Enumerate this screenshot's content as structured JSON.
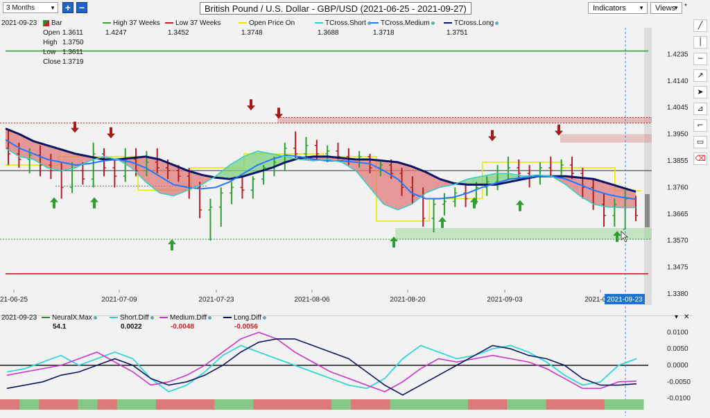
{
  "toolbar": {
    "range": "3 Months",
    "zoom_in": "+",
    "zoom_out": "−",
    "title": "British Pound / U.S. Dollar - GBP/USD (2021-06-25 - 2021-09-27)",
    "indicators": "Indicators",
    "views": "Views",
    "views_star": "*"
  },
  "legend": {
    "date": "2021-09-23",
    "bar_label": "Bar",
    "ohlc_labels": [
      "Open",
      "High",
      "Low",
      "Close"
    ],
    "ohlc_values": [
      "1.3611",
      "1.3750",
      "1.3611",
      "1.3719"
    ],
    "items": [
      {
        "name": "High 37 Weeks",
        "value": "1.4247",
        "color": "#3aa13a"
      },
      {
        "name": "Low 37 Weeks",
        "value": "1.3452",
        "color": "#cc1f1f"
      },
      {
        "name": "Open Price On",
        "value": "1.3748",
        "color": "#e8e800"
      },
      {
        "name": "TCross.Short",
        "value": "1.3688",
        "color": "#33cccc"
      },
      {
        "name": "TCross.Medium",
        "value": "1.3718",
        "color": "#2277ff"
      },
      {
        "name": "TCross.Long",
        "value": "1.3751",
        "color": "#0a1466"
      }
    ]
  },
  "lower_legend": {
    "date": "2021-09-23",
    "items": [
      {
        "name": "NeuralX.Max",
        "value": "54.1",
        "color": "#2e8b2e",
        "value_color": "#111111"
      },
      {
        "name": "Short.Diff",
        "value": "0.0022",
        "color": "#33cccc",
        "value_color": "#111111"
      },
      {
        "name": "Medium.Diff",
        "value": "-0.0048",
        "color": "#cc33cc",
        "value_color": "#cc1f1f"
      },
      {
        "name": "Long.Diff",
        "value": "-0.0056",
        "color": "#0a1466",
        "value_color": "#cc1f1f"
      }
    ],
    "ctrl_down": "▾",
    "ctrl_close": "✕"
  },
  "tools": [
    {
      "name": "draw-line-icon",
      "glyph": "╱"
    },
    {
      "name": "vertical-line-icon",
      "glyph": "│"
    },
    {
      "name": "horizontal-line-icon",
      "glyph": "─"
    },
    {
      "name": "ray-icon",
      "glyph": "↗"
    },
    {
      "name": "pointer-icon",
      "glyph": "➤"
    },
    {
      "name": "pitchfork-icon",
      "glyph": "⊿"
    },
    {
      "name": "bracket-icon",
      "glyph": "⌐"
    },
    {
      "name": "rectangle-icon",
      "glyph": "▭"
    },
    {
      "name": "delete-drawing-icon",
      "glyph": "⌫"
    }
  ],
  "chart_data": [
    {
      "type": "line",
      "ylim": [
        1.338,
        1.433
      ],
      "y_ticks": [
        "1.4235",
        "1.4140",
        "1.4045",
        "1.3950",
        "1.3855",
        "1.3760",
        "1.3665",
        "1.3570",
        "1.3475",
        "1.3380"
      ],
      "x_labels": [
        "21-06-25",
        "2021-07-09",
        "2021-07-23",
        "2021-08-06",
        "2021-08-20",
        "2021-09-03",
        "2021-09-1"
      ],
      "cursor_label": "2021-09-23",
      "current_price": "1.3719",
      "grid": false,
      "levels": {
        "high_37_weeks": 1.4247,
        "low_37_weeks": 1.3452,
        "open_price": 1.3748
      },
      "bars": [
        [
          1.39,
          1.3965,
          1.384,
          1.388
        ],
        [
          1.388,
          1.392,
          1.383,
          1.386
        ],
        [
          1.386,
          1.39,
          1.381,
          1.3875
        ],
        [
          1.3875,
          1.391,
          1.38,
          1.384
        ],
        [
          1.384,
          1.388,
          1.379,
          1.382
        ],
        [
          1.382,
          1.385,
          1.372,
          1.376
        ],
        [
          1.376,
          1.385,
          1.374,
          1.382
        ],
        [
          1.382,
          1.385,
          1.377,
          1.379
        ],
        [
          1.379,
          1.392,
          1.376,
          1.388
        ],
        [
          1.388,
          1.39,
          1.38,
          1.383
        ],
        [
          1.383,
          1.386,
          1.376,
          1.38
        ],
        [
          1.38,
          1.39,
          1.378,
          1.386
        ],
        [
          1.386,
          1.39,
          1.38,
          1.382
        ],
        [
          1.382,
          1.389,
          1.38,
          1.385
        ],
        [
          1.385,
          1.39,
          1.381,
          1.383
        ],
        [
          1.383,
          1.386,
          1.379,
          1.382
        ],
        [
          1.382,
          1.384,
          1.378,
          1.38
        ],
        [
          1.38,
          1.383,
          1.372,
          1.376
        ],
        [
          1.376,
          1.378,
          1.365,
          1.368
        ],
        [
          1.368,
          1.372,
          1.357,
          1.369
        ],
        [
          1.369,
          1.376,
          1.362,
          1.374
        ],
        [
          1.374,
          1.378,
          1.37,
          1.376
        ],
        [
          1.376,
          1.38,
          1.372,
          1.375
        ],
        [
          1.375,
          1.38,
          1.372,
          1.379
        ],
        [
          1.379,
          1.384,
          1.377,
          1.383
        ],
        [
          1.383,
          1.387,
          1.38,
          1.385
        ],
        [
          1.385,
          1.392,
          1.382,
          1.39
        ],
        [
          1.39,
          1.396,
          1.386,
          1.388
        ],
        [
          1.388,
          1.394,
          1.386,
          1.391
        ],
        [
          1.391,
          1.393,
          1.386,
          1.388
        ],
        [
          1.388,
          1.391,
          1.385,
          1.389
        ],
        [
          1.389,
          1.392,
          1.386,
          1.387
        ],
        [
          1.387,
          1.39,
          1.384,
          1.386
        ],
        [
          1.386,
          1.389,
          1.383,
          1.387
        ],
        [
          1.387,
          1.388,
          1.381,
          1.383
        ],
        [
          1.383,
          1.386,
          1.38,
          1.384
        ],
        [
          1.384,
          1.386,
          1.379,
          1.381
        ],
        [
          1.381,
          1.383,
          1.373,
          1.376
        ],
        [
          1.376,
          1.38,
          1.37,
          1.373
        ],
        [
          1.373,
          1.376,
          1.362,
          1.365
        ],
        [
          1.365,
          1.372,
          1.36,
          1.37
        ],
        [
          1.37,
          1.374,
          1.366,
          1.371
        ],
        [
          1.371,
          1.376,
          1.369,
          1.374
        ],
        [
          1.374,
          1.377,
          1.369,
          1.372
        ],
        [
          1.372,
          1.378,
          1.37,
          1.376
        ],
        [
          1.376,
          1.38,
          1.373,
          1.378
        ],
        [
          1.378,
          1.384,
          1.375,
          1.382
        ],
        [
          1.382,
          1.387,
          1.379,
          1.383
        ],
        [
          1.383,
          1.386,
          1.379,
          1.381
        ],
        [
          1.381,
          1.384,
          1.376,
          1.38
        ],
        [
          1.38,
          1.385,
          1.377,
          1.383
        ],
        [
          1.383,
          1.387,
          1.38,
          1.382
        ],
        [
          1.382,
          1.386,
          1.38,
          1.384
        ],
        [
          1.384,
          1.387,
          1.379,
          1.381
        ],
        [
          1.381,
          1.383,
          1.372,
          1.376
        ],
        [
          1.376,
          1.379,
          1.368,
          1.37
        ],
        [
          1.37,
          1.374,
          1.362,
          1.366
        ],
        [
          1.366,
          1.372,
          1.362,
          1.37
        ],
        [
          1.3611,
          1.375,
          1.3611,
          1.3719
        ],
        [
          1.3719,
          1.373,
          1.364,
          1.366
        ]
      ],
      "series": [
        {
          "name": "TCross.Long",
          "values": [
            1.397,
            1.395,
            1.3925,
            1.391,
            1.3895,
            1.388,
            1.387,
            1.386,
            1.386,
            1.3865,
            1.387,
            1.386,
            1.384,
            1.382,
            1.3805,
            1.3795,
            1.379,
            1.38,
            1.3815,
            1.383,
            1.385,
            1.3865,
            1.387,
            1.387,
            1.3865,
            1.386,
            1.386,
            1.3855,
            1.385,
            1.3835,
            1.3815,
            1.379,
            1.3775,
            1.377,
            1.377,
            1.377,
            1.378,
            1.379,
            1.38,
            1.38,
            1.38,
            1.3795,
            1.379,
            1.3775,
            1.376,
            1.3745
          ]
        },
        {
          "name": "TCross.Medium",
          "values": [
            1.393,
            1.39,
            1.388,
            1.386,
            1.385,
            1.384,
            1.3845,
            1.3855,
            1.386,
            1.385,
            1.383,
            1.38,
            1.377,
            1.376,
            1.3755,
            1.376,
            1.378,
            1.381,
            1.384,
            1.386,
            1.3875,
            1.387,
            1.386,
            1.3855,
            1.3855,
            1.385,
            1.3845,
            1.382,
            1.379,
            1.374,
            1.372,
            1.372,
            1.3725,
            1.374,
            1.376,
            1.3775,
            1.379,
            1.3795,
            1.38,
            1.38,
            1.379,
            1.377,
            1.375,
            1.3735,
            1.3725,
            1.3718
          ]
        },
        {
          "name": "TCross.Short",
          "values": [
            1.39,
            1.387,
            1.386,
            1.383,
            1.382,
            1.383,
            1.3855,
            1.387,
            1.386,
            1.383,
            1.378,
            1.374,
            1.373,
            1.375,
            1.377,
            1.38,
            1.384,
            1.387,
            1.389,
            1.388,
            1.387,
            1.386,
            1.3855,
            1.386,
            1.385,
            1.382,
            1.376,
            1.37,
            1.368,
            1.37,
            1.374,
            1.376,
            1.377,
            1.379,
            1.38,
            1.381,
            1.381,
            1.38,
            1.3805,
            1.38,
            1.377,
            1.373,
            1.37,
            1.369,
            1.3688,
            1.3688
          ]
        }
      ]
    },
    {
      "type": "line",
      "ylim": [
        -0.0105,
        0.0105
      ],
      "y_ticks": [
        "0.0100",
        "0.0050",
        "0.0000",
        "-0.0050",
        "-0.0100"
      ],
      "grid": false,
      "series": [
        {
          "name": "Short.Diff",
          "values": [
            -0.002,
            -0.001,
            0.001,
            0.003,
            0.0,
            0.002,
            0.004,
            0.002,
            -0.004,
            -0.008,
            -0.006,
            -0.002,
            0.003,
            0.006,
            0.004,
            0.002,
            0.0,
            -0.002,
            -0.004,
            -0.006,
            -0.007,
            -0.004,
            0.002,
            0.006,
            0.004,
            0.002,
            0.003,
            0.005,
            0.006,
            0.004,
            0.001,
            -0.003,
            -0.006,
            -0.005,
            0.0,
            0.002
          ]
        },
        {
          "name": "Medium.Diff",
          "values": [
            -0.003,
            -0.002,
            -0.001,
            0.0,
            0.002,
            0.004,
            0.001,
            -0.002,
            -0.006,
            -0.005,
            -0.003,
            0.0,
            0.004,
            0.008,
            0.01,
            0.008,
            0.004,
            0.001,
            -0.002,
            -0.004,
            -0.006,
            -0.008,
            -0.005,
            -0.001,
            0.002,
            0.001,
            0.002,
            0.003,
            0.002,
            0.001,
            -0.001,
            -0.004,
            -0.007,
            -0.007,
            -0.005,
            -0.0048
          ]
        },
        {
          "name": "Long.Diff",
          "values": [
            -0.007,
            -0.006,
            -0.005,
            -0.003,
            -0.002,
            0.0,
            0.002,
            0.0,
            -0.004,
            -0.006,
            -0.005,
            -0.003,
            0.0,
            0.004,
            0.007,
            0.008,
            0.008,
            0.006,
            0.004,
            0.002,
            -0.002,
            -0.006,
            -0.009,
            -0.006,
            -0.003,
            0.0,
            0.003,
            0.006,
            0.005,
            0.003,
            0.002,
            0.0,
            -0.004,
            -0.006,
            -0.006,
            -0.0056
          ]
        }
      ],
      "signal_bar": [
        "red",
        "green",
        "red",
        "red",
        "green",
        "red",
        "green",
        "green",
        "red",
        "red",
        "red",
        "green",
        "green",
        "red",
        "red",
        "red",
        "red",
        "green",
        "red",
        "red",
        "green",
        "green",
        "green",
        "green",
        "red",
        "red",
        "green",
        "green",
        "red",
        "red",
        "red",
        "green",
        "green"
      ]
    }
  ]
}
